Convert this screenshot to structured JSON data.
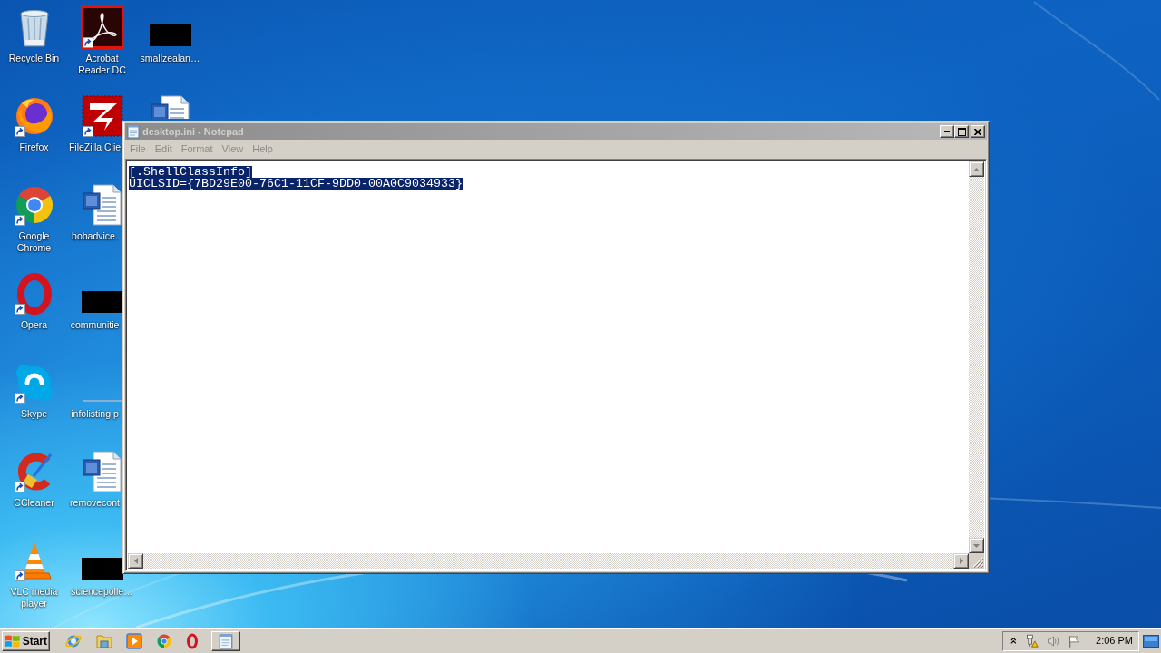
{
  "desktop_icons": [
    {
      "kind": "recycle-bin",
      "label": "Recycle Bin",
      "shortcut": false
    },
    {
      "kind": "firefox",
      "label": "Firefox",
      "shortcut": true
    },
    {
      "kind": "chrome",
      "label": "Google Chrome",
      "shortcut": true
    },
    {
      "kind": "opera",
      "label": "Opera",
      "shortcut": true
    },
    {
      "kind": "skype",
      "label": "Skype",
      "shortcut": true
    },
    {
      "kind": "ccleaner",
      "label": "CCleaner",
      "shortcut": true
    },
    {
      "kind": "vlc",
      "label": "VLC media player",
      "shortcut": true
    },
    {
      "kind": "pdf-app",
      "label": "Acrobat Reader DC",
      "shortcut": true
    },
    {
      "kind": "filezilla",
      "label": "FileZilla Clie",
      "shortcut": true
    },
    {
      "kind": "word-doc",
      "label": "bobadvice.",
      "shortcut": false
    },
    {
      "kind": "dark-thumbnail",
      "label": "communitie",
      "shortcut": false
    },
    {
      "kind": "blank",
      "label": "infolisting.p",
      "shortcut": false
    },
    {
      "kind": "word-doc",
      "label": "removecont",
      "shortcut": false
    },
    {
      "kind": "dark-thumbnail",
      "label": "sciencepolle…",
      "shortcut": false
    },
    {
      "kind": "dark-thumbnail",
      "label": "smallzealan…",
      "shortcut": false
    },
    {
      "kind": "word-doc",
      "shortcut": false
    }
  ],
  "window": {
    "title": "desktop.ini - Notepad",
    "active": false,
    "menu": [
      "File",
      "Edit",
      "Format",
      "View",
      "Help"
    ],
    "lines": [
      {
        "text": "[.ShellClassInfo]",
        "selected": true
      },
      {
        "text": "UICLSID={7BD29E00-76C1-11CF-9DD0-00A0C9034933}",
        "selected": true
      }
    ]
  },
  "taskbar": {
    "start_label": "Start",
    "tasks": [
      {
        "selected": false
      }
    ],
    "clock": "2:06 PM"
  }
}
